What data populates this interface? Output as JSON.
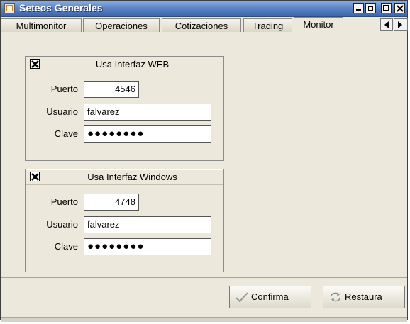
{
  "window": {
    "title": "Seteos Generales"
  },
  "tabs": [
    {
      "label": "Multimonitor"
    },
    {
      "label": "Operaciones"
    },
    {
      "label": "Cotizaciones"
    },
    {
      "label": "Trading"
    },
    {
      "label": "Monitor"
    }
  ],
  "active_tab": "Monitor",
  "groups": {
    "web": {
      "checked": true,
      "title": "Usa Interfaz WEB",
      "puerto_label": "Puerto",
      "puerto_value": "4546",
      "usuario_label": "Usuario",
      "usuario_value": "falvarez",
      "clave_label": "Clave",
      "clave_value": "●●●●●●●●"
    },
    "windows": {
      "checked": true,
      "title": "Usa Interfaz Windows",
      "puerto_label": "Puerto",
      "puerto_value": "4748",
      "usuario_label": "Usuario",
      "usuario_value": "falvarez",
      "clave_label": "Clave",
      "clave_value": "●●●●●●●●"
    }
  },
  "buttons": {
    "confirma": "Confirma",
    "restaura": "Restaura"
  },
  "colors": {
    "titlebar": "#5e86c6",
    "background": "#ece9dc",
    "confirm_icon": "#9a9a9a"
  },
  "icons": [
    "app-icon",
    "minimize-icon",
    "restore-icon",
    "maximize-icon",
    "close-icon",
    "scroll-left-icon",
    "scroll-right-icon",
    "checkmark-icon",
    "refresh-icon"
  ]
}
